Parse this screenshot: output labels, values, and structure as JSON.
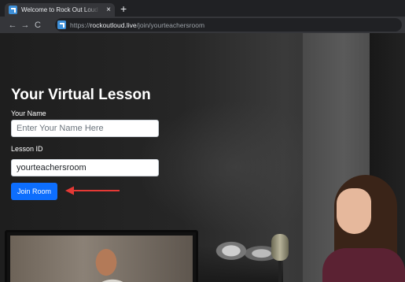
{
  "browser": {
    "tab_title": "Welcome to Rock Out Loud Live",
    "tab_close": "×",
    "new_tab": "+",
    "url_scheme": "https://",
    "url_domain": "rockoutloud.live",
    "url_path": "/join/yourteachersroom"
  },
  "icons": {
    "back": "←",
    "forward": "→",
    "reload": "C"
  },
  "form": {
    "title": "Your Virtual Lesson",
    "name_label": "Your Name",
    "name_placeholder": "Enter Your Name Here",
    "lesson_label": "Lesson ID",
    "lesson_value": "yourteachersroom",
    "join_label": "Join Room"
  },
  "colors": {
    "accent": "#0d6efd",
    "annotation_arrow": "#e53935",
    "favicon": "#3d8fd8"
  }
}
